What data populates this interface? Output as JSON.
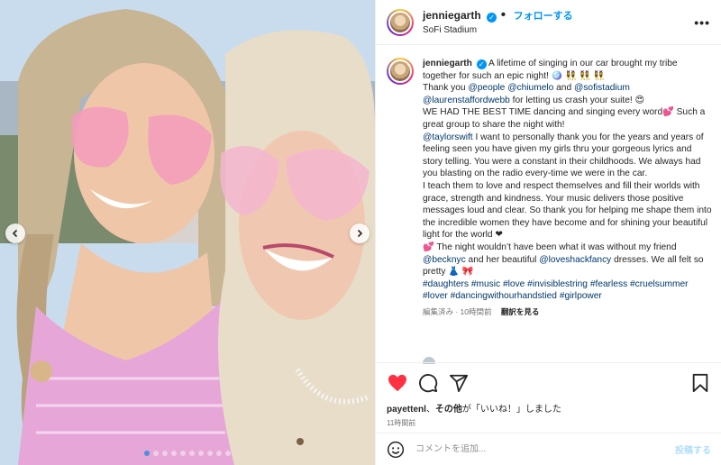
{
  "header": {
    "username": "jenniegarth",
    "verified_icon": "✓",
    "follow_label": "フォローする",
    "location": "SoFi Stadium",
    "more_icon": "•••"
  },
  "caption": {
    "username": "jenniegarth",
    "lines": [
      {
        "parts": [
          {
            "t": "A lifetime of singing in our car brought my tribe together for such an epic night! 🪩 👯‍♀️ 👯‍♀️ 👯‍♀️"
          }
        ]
      },
      {
        "parts": [
          {
            "t": "Thank you "
          },
          {
            "t": "@people",
            "link": true
          },
          {
            "t": " "
          },
          {
            "t": "@chiumelo",
            "link": true
          },
          {
            "t": " and "
          },
          {
            "t": "@sofistadium",
            "link": true
          },
          {
            "t": " "
          },
          {
            "t": "@laurenstaffordwebb",
            "link": true
          },
          {
            "t": " for letting us crash your suite! 😍"
          }
        ]
      },
      {
        "parts": [
          {
            "t": "WE HAD THE BEST TIME dancing and singing every word💕  Such a great group to share the night with!"
          }
        ]
      },
      {
        "parts": [
          {
            "t": "@taylorswift",
            "link": true
          },
          {
            "t": " I want to personally thank you for the years and years of feeling seen you have given my girls thru your gorgeous lyrics and story telling. You were a constant in their childhoods. We always had you blasting on the radio every-time we were in the car."
          }
        ]
      },
      {
        "parts": [
          {
            "t": "I teach them to love and respect themselves and fill their worlds with grace, strength and kindness. Your music delivers those positive messages loud and clear. So thank you for helping me shape them into the incredible women they have become and for shining your beautiful light for the world ❤"
          }
        ]
      },
      {
        "parts": [
          {
            "t": "💕 The night wouldn’t have been what it was without my friend "
          },
          {
            "t": "@becknyc",
            "link": true
          },
          {
            "t": " and her beautiful "
          },
          {
            "t": "@loveshackfancy",
            "link": true
          },
          {
            "t": " dresses. We all felt so pretty 👗 🎀"
          }
        ]
      },
      {
        "parts": [
          {
            "t": "#daughters",
            "link": true
          },
          {
            "t": " "
          },
          {
            "t": "#music",
            "link": true
          },
          {
            "t": " "
          },
          {
            "t": "#love",
            "link": true
          },
          {
            "t": " "
          },
          {
            "t": "#invisiblestring",
            "link": true
          },
          {
            "t": " "
          },
          {
            "t": "#fearless",
            "link": true
          },
          {
            "t": " "
          },
          {
            "t": "#cruelsummer",
            "link": true
          },
          {
            "t": " "
          },
          {
            "t": "#lover",
            "link": true
          },
          {
            "t": " "
          },
          {
            "t": "#dancingwithourhandstied",
            "link": true
          },
          {
            "t": " "
          },
          {
            "t": "#girlpower",
            "link": true
          }
        ]
      }
    ],
    "meta_edited": "編集済み · 10時間前",
    "translate_label": "翻訳を見る"
  },
  "actions": {
    "like_icon": "heart-icon",
    "comment_icon": "comment-icon",
    "share_icon": "share-icon",
    "save_icon": "bookmark-icon",
    "liked_by_user": "payettenl",
    "liked_by_middle": "、",
    "liked_by_others": "その他",
    "liked_by_suffix": "が「いいね！」しました",
    "time": "11時間前"
  },
  "comment": {
    "placeholder": "コメントを追加...",
    "post_label": "投稿する"
  },
  "photo": {
    "carousel_count": 10,
    "carousel_active": 1
  },
  "colors": {
    "accent": "#0095f6",
    "like_red": "#ff3040",
    "link": "#00376b"
  }
}
